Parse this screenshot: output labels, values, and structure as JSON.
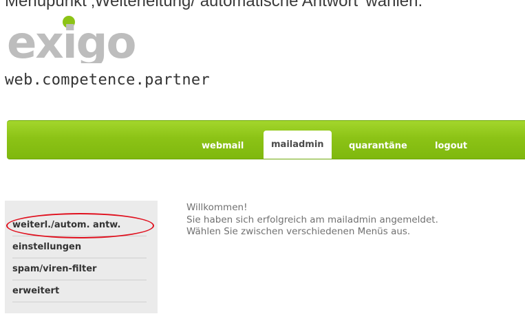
{
  "caption": "Menüpunkt ‚Weiterleitung/ automatische Antwort' wählen.",
  "logo": {
    "text": "exigo",
    "accent_color": "#8cc316",
    "text_color": "#bdbdbd"
  },
  "tagline": "web.competence.partner",
  "nav": {
    "items": [
      {
        "label": "webmail"
      },
      {
        "label": "mailadmin"
      },
      {
        "label": "quarantäne"
      },
      {
        "label": "logout"
      }
    ],
    "active": "mailadmin",
    "bar_color": "#8cc316"
  },
  "sidebar": {
    "items": [
      {
        "label": "weiterl./autom. antw."
      },
      {
        "label": "einstellungen"
      },
      {
        "label": "spam/viren-filter"
      },
      {
        "label": "erweitert"
      }
    ],
    "highlighted": "weiterl./autom. antw.",
    "highlight_color": "#e0101e"
  },
  "main": {
    "lines": [
      "Willkommen!",
      "Sie haben sich erfolgreich am mailadmin angemeldet.",
      "Wählen Sie zwischen verschiedenen Menüs aus."
    ]
  }
}
